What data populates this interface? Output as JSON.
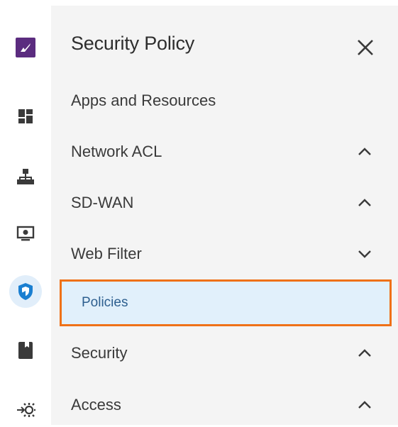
{
  "colors": {
    "brand": "#5b2c7f",
    "accent": "#1a7fd1",
    "highlight_border": "#ef7118",
    "highlight_fill": "#e1f0fb"
  },
  "rail": {
    "items": [
      {
        "icon": "logo-icon"
      },
      {
        "icon": "dashboard-icon"
      },
      {
        "icon": "network-topology-icon"
      },
      {
        "icon": "monitor-icon"
      },
      {
        "icon": "shield-icon",
        "active": true
      },
      {
        "icon": "book-icon"
      },
      {
        "icon": "integrations-icon"
      }
    ]
  },
  "panel": {
    "title": "Security Policy",
    "close_icon": "close-icon",
    "items": [
      {
        "label": "Apps and Resources"
      },
      {
        "label": "Network ACL",
        "chevron": "up"
      },
      {
        "label": "SD-WAN",
        "chevron": "up"
      },
      {
        "label": "Web Filter",
        "chevron": "down",
        "children": [
          {
            "label": "Policies",
            "selected": true
          }
        ]
      },
      {
        "label": "Security",
        "chevron": "up"
      },
      {
        "label": "Access",
        "chevron": "up"
      }
    ]
  }
}
